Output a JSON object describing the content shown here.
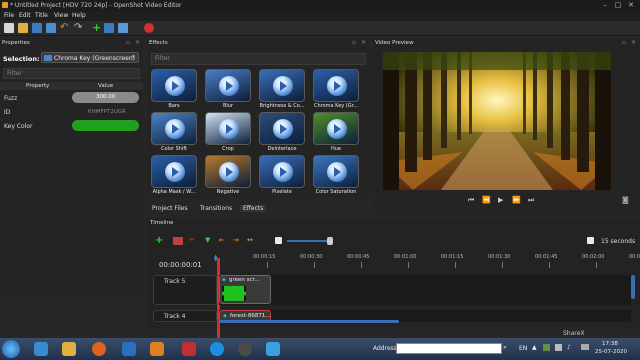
{
  "app": {
    "title": "* Untitled Project [HDV 720 24p] - OpenShot Video Editor",
    "menu": [
      "File",
      "Edit",
      "Title",
      "View",
      "Help"
    ]
  },
  "properties": {
    "header": "Properties",
    "selection_label": "Selection:",
    "selection_value": "Chroma Key (Greenscreen)",
    "filter_placeholder": "Filter",
    "col_property": "Property",
    "col_value": "Value",
    "rows": [
      {
        "name": "Fuzz",
        "value": "300.00"
      },
      {
        "name": "ID",
        "value": "KHMFPT2UGR"
      },
      {
        "name": "Key Color",
        "value": ""
      }
    ],
    "key_color": "#1fa01f"
  },
  "effects": {
    "header": "Effects",
    "filter_placeholder": "Filter",
    "items": [
      {
        "label": "Bars",
        "bg": "#2a5fa8"
      },
      {
        "label": "Blur",
        "bg": "#4a7fc8"
      },
      {
        "label": "Brightness & Co...",
        "bg": "#3a6fb8"
      },
      {
        "label": "Chroma Key (Gr...",
        "bg": "#2f5fa8"
      },
      {
        "label": "Color Shift",
        "bg": "#4a84c8"
      },
      {
        "label": "Crop",
        "bg": "#d0e4f4"
      },
      {
        "label": "Deinterlace",
        "bg": "#2c4d78"
      },
      {
        "label": "Hue",
        "bg": "#4f8f2a"
      },
      {
        "label": "Alpha Mask / W...",
        "bg": "#2a5fa8"
      },
      {
        "label": "Negative",
        "bg": "#b87a2a"
      },
      {
        "label": "Pixelate",
        "bg": "#3a6fb8"
      },
      {
        "label": "Color Saturation",
        "bg": "#3a78c0"
      }
    ]
  },
  "tabs": [
    "Project Files",
    "Transitions",
    "Effects"
  ],
  "preview": {
    "header": "Video Preview"
  },
  "timeline": {
    "header": "Timeline",
    "timecode": "00:00:00:01",
    "zoom_label": "15 seconds",
    "ruler": [
      "00:00:15",
      "00:00:30",
      "00:00:45",
      "00:01:00",
      "00:01:15",
      "00:01:30",
      "00:01:45",
      "00:02:00",
      "00:02:15"
    ],
    "tracks": [
      {
        "name": "Track 5",
        "clip": "green scr..."
      },
      {
        "name": "Track 4",
        "clip": "forest-86871..."
      }
    ]
  },
  "sharex": "ShareX",
  "taskbar": {
    "address_label": "Address",
    "lang": "EN",
    "time": "17:38",
    "date": "25-07-2020"
  }
}
